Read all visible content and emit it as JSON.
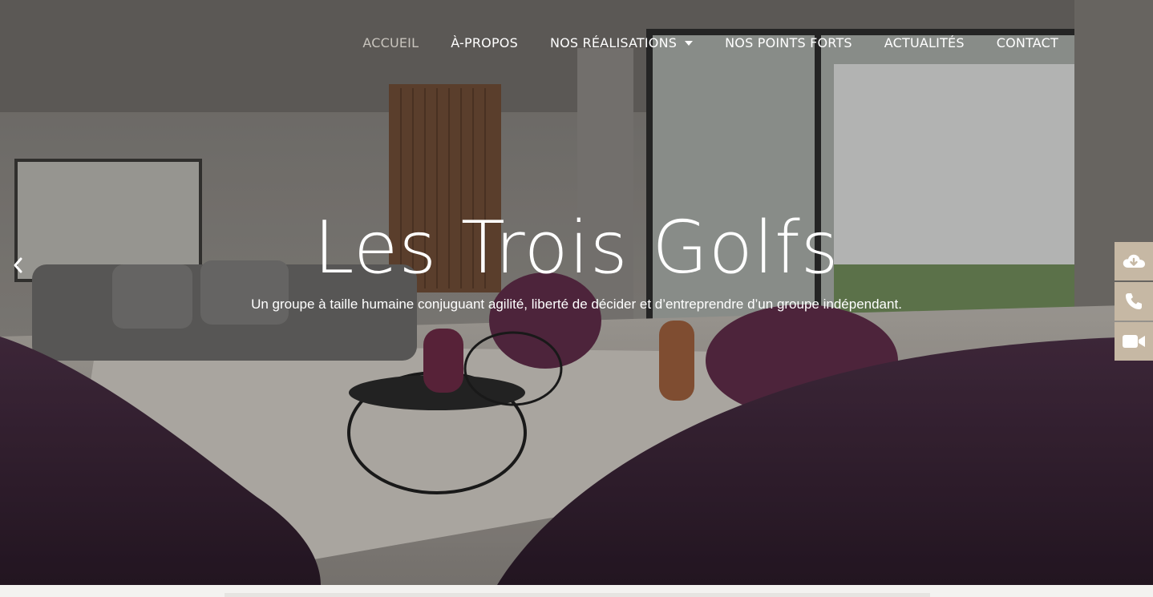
{
  "nav": {
    "items": [
      {
        "label": "ACCUEIL",
        "active": true
      },
      {
        "label": "À-PROPOS",
        "active": false
      },
      {
        "label": "NOS RÉALISATIONS",
        "active": false,
        "dropdown": true
      },
      {
        "label": "NOS POINTS FORTS",
        "active": false
      },
      {
        "label": "ACTUALITÉS",
        "active": false
      },
      {
        "label": "CONTACT",
        "active": false
      }
    ]
  },
  "hero": {
    "title": "Les Trois Golfs",
    "subtitle": "Un groupe à taille humaine conjuguant agilité, liberté de décider et d’entreprendre d’un groupe indépendant.",
    "image_description_icon": "living-room-photo"
  },
  "side_actions": [
    {
      "icon": "cloud-download-icon"
    },
    {
      "icon": "phone-icon"
    },
    {
      "icon": "video-camera-icon"
    }
  ],
  "colors": {
    "nav_active": "#c8c4bd",
    "side_button_bg": "#c6b8a4",
    "text": "#ffffff"
  }
}
